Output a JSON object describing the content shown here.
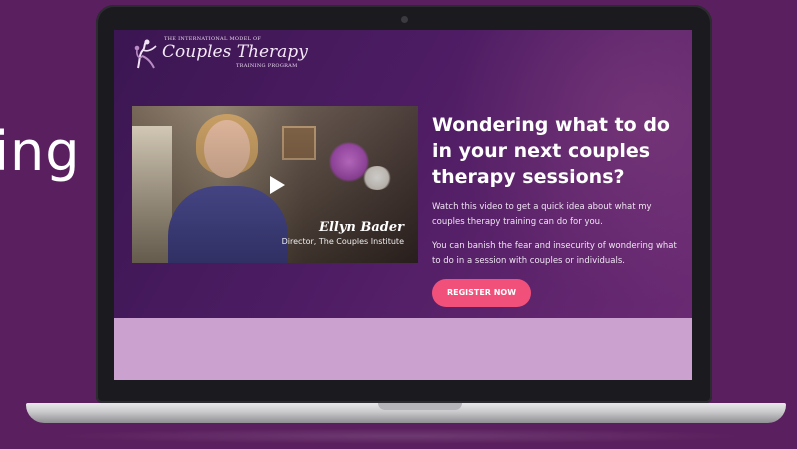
{
  "slide": {
    "partial_text": "ing"
  },
  "page": {
    "logo": {
      "top_line": "THE INTERNATIONAL MODEL OF",
      "title": "Couples Therapy",
      "sub_line": "TRAINING PROGRAM"
    },
    "video": {
      "speaker_name": "Ellyn Bader",
      "speaker_role": "Director, The Couples Institute",
      "play_icon": "play-icon"
    },
    "headline": "Wondering what to do in your next couples therapy sessions?",
    "paragraphs": [
      "Watch this video to get a quick idea about what my couples therapy training can do for you.",
      "You can banish the fear and insecurity of wondering what to do in a session with couples or individuals."
    ],
    "cta_label": "REGISTER NOW"
  },
  "colors": {
    "background": "#5a1f5e",
    "hero_gradient_start": "#3b1652",
    "hero_gradient_end": "#6a2a73",
    "cta": "#f0507a",
    "screen_lower": "#caa1cf"
  }
}
